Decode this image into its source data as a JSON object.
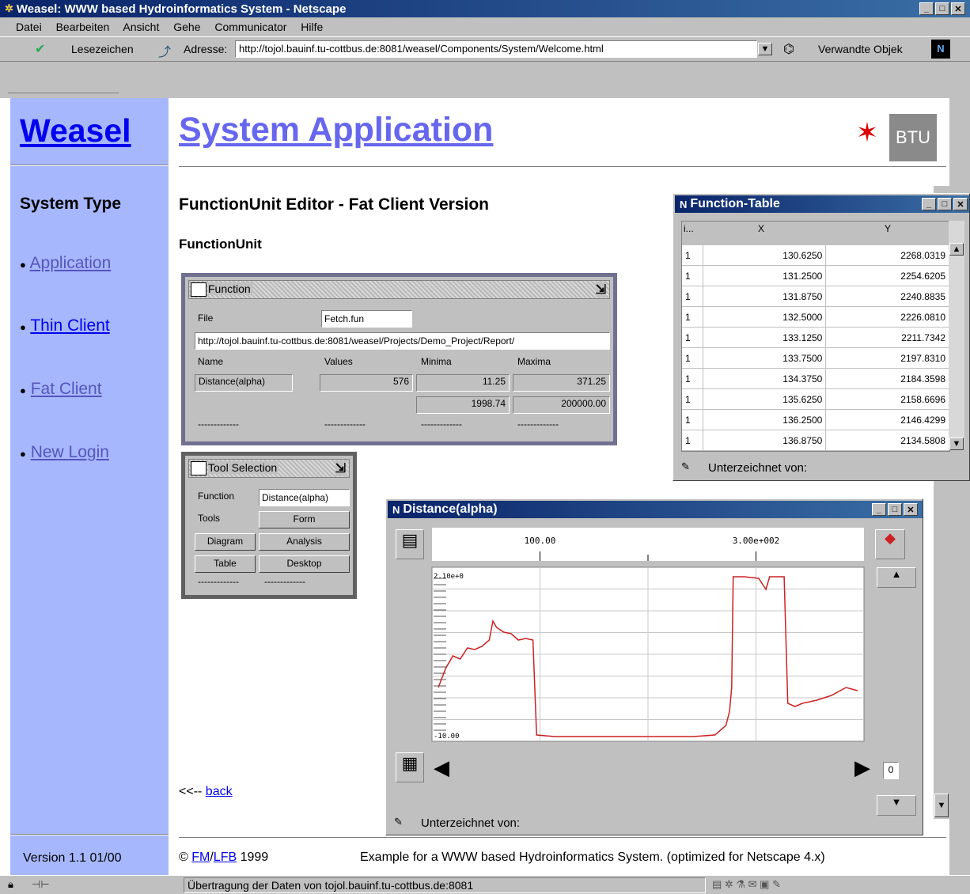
{
  "window": {
    "title": "Weasel: WWW based Hydroinformatics System - Netscape"
  },
  "menu": [
    "Datei",
    "Bearbeiten",
    "Ansicht",
    "Gehe",
    "Communicator",
    "Hilfe"
  ],
  "toolbar": {
    "bookmarks": "Lesezeichen",
    "address_label": "Adresse:",
    "address_value": "http://tojol.bauinf.tu-cottbus.de:8081/weasel/Components/System/Welcome.html",
    "related": "Verwandte Objek"
  },
  "sidebar": {
    "logo": "Weasel",
    "section_title": "System Type",
    "items": [
      "Application",
      "Thin Client",
      "Fat Client",
      "New Login"
    ],
    "version": "Version 1.1 01/00"
  },
  "header": {
    "title": "System Application",
    "badge": "BTU"
  },
  "content": {
    "heading": "FunctionUnit Editor - Fat Client Version",
    "subheading": "FunctionUnit",
    "back_prefix": "<<-- ",
    "back_link": "back"
  },
  "function_panel": {
    "title": "Function",
    "file_label": "File",
    "file_value": "Fetch.fun",
    "url": "http://tojol.bauinf.tu-cottbus.de:8081/weasel/Projects/Demo_Project/Report/",
    "cols": [
      "Name",
      "Values",
      "Minima",
      "Maxima"
    ],
    "name": "Distance(alpha)",
    "values": "576",
    "min1": "11.25",
    "max1": "371.25",
    "min2": "1998.74",
    "max2": "200000.00",
    "dashes": "-------------"
  },
  "tool_panel": {
    "title": "Tool Selection",
    "function_label": "Function",
    "function_value": "Distance(alpha)",
    "tools_label": "Tools",
    "form": "Form",
    "diagram": "Diagram",
    "analysis": "Analysis",
    "table": "Table",
    "desktop": "Desktop",
    "dashes": "-------------"
  },
  "function_table": {
    "title": "Function-Table",
    "headers": [
      "i...",
      "X",
      "Y"
    ],
    "rows": [
      [
        "1",
        "130.6250",
        "2268.0319"
      ],
      [
        "1",
        "131.2500",
        "2254.6205"
      ],
      [
        "1",
        "131.8750",
        "2240.8835"
      ],
      [
        "1",
        "132.5000",
        "2226.0810"
      ],
      [
        "1",
        "133.1250",
        "2211.7342"
      ],
      [
        "1",
        "133.7500",
        "2197.8310"
      ],
      [
        "1",
        "134.3750",
        "2184.3598"
      ],
      [
        "1",
        "135.6250",
        "2158.6696"
      ],
      [
        "1",
        "136.2500",
        "2146.4299"
      ],
      [
        "1",
        "136.8750",
        "2134.5808"
      ]
    ],
    "status": "Unterzeichnet von:"
  },
  "diagram_window": {
    "title": "Distance(alpha)",
    "status": "Unterzeichnet von:",
    "spin_value": "0",
    "line_color": "#cc2222"
  },
  "chart_data": {
    "type": "line",
    "xticks": [
      "100.00",
      "3.00e+002"
    ],
    "ytick_top": "2.10e+0",
    "ytick_bottom": "-10.00",
    "xlim": [
      0,
      576
    ],
    "ylim": [
      0,
      100
    ],
    "series": [
      {
        "values": [
          [
            0,
            30
          ],
          [
            10,
            42
          ],
          [
            20,
            50
          ],
          [
            30,
            48
          ],
          [
            40,
            55
          ],
          [
            50,
            54
          ],
          [
            60,
            56
          ],
          [
            70,
            60
          ],
          [
            75,
            72
          ],
          [
            80,
            68
          ],
          [
            90,
            65
          ],
          [
            100,
            64
          ],
          [
            110,
            60
          ],
          [
            120,
            61
          ],
          [
            130,
            60
          ],
          [
            135,
            0
          ],
          [
            160,
            -1
          ],
          [
            200,
            -1
          ],
          [
            250,
            -1
          ],
          [
            300,
            -1
          ],
          [
            350,
            -1
          ],
          [
            380,
            0
          ],
          [
            395,
            6
          ],
          [
            400,
            15
          ],
          [
            403,
            30
          ],
          [
            405,
            100
          ],
          [
            420,
            100
          ],
          [
            440,
            99
          ],
          [
            450,
            92
          ],
          [
            455,
            100
          ],
          [
            470,
            100
          ],
          [
            475,
            100
          ],
          [
            480,
            20
          ],
          [
            490,
            18
          ],
          [
            500,
            20
          ],
          [
            520,
            22
          ],
          [
            540,
            25
          ],
          [
            560,
            30
          ],
          [
            576,
            28
          ]
        ]
      }
    ]
  },
  "footer": {
    "copyright": "© ",
    "fm": "FM",
    "slash": "/",
    "lfb": "LFB",
    "year": " 1999",
    "note": "Example for a WWW based Hydroinformatics System. (optimized for Netscape 4.x)"
  },
  "statusbar": {
    "text": "Übertragung der Daten von tojol.bauinf.tu-cottbus.de:8081"
  }
}
